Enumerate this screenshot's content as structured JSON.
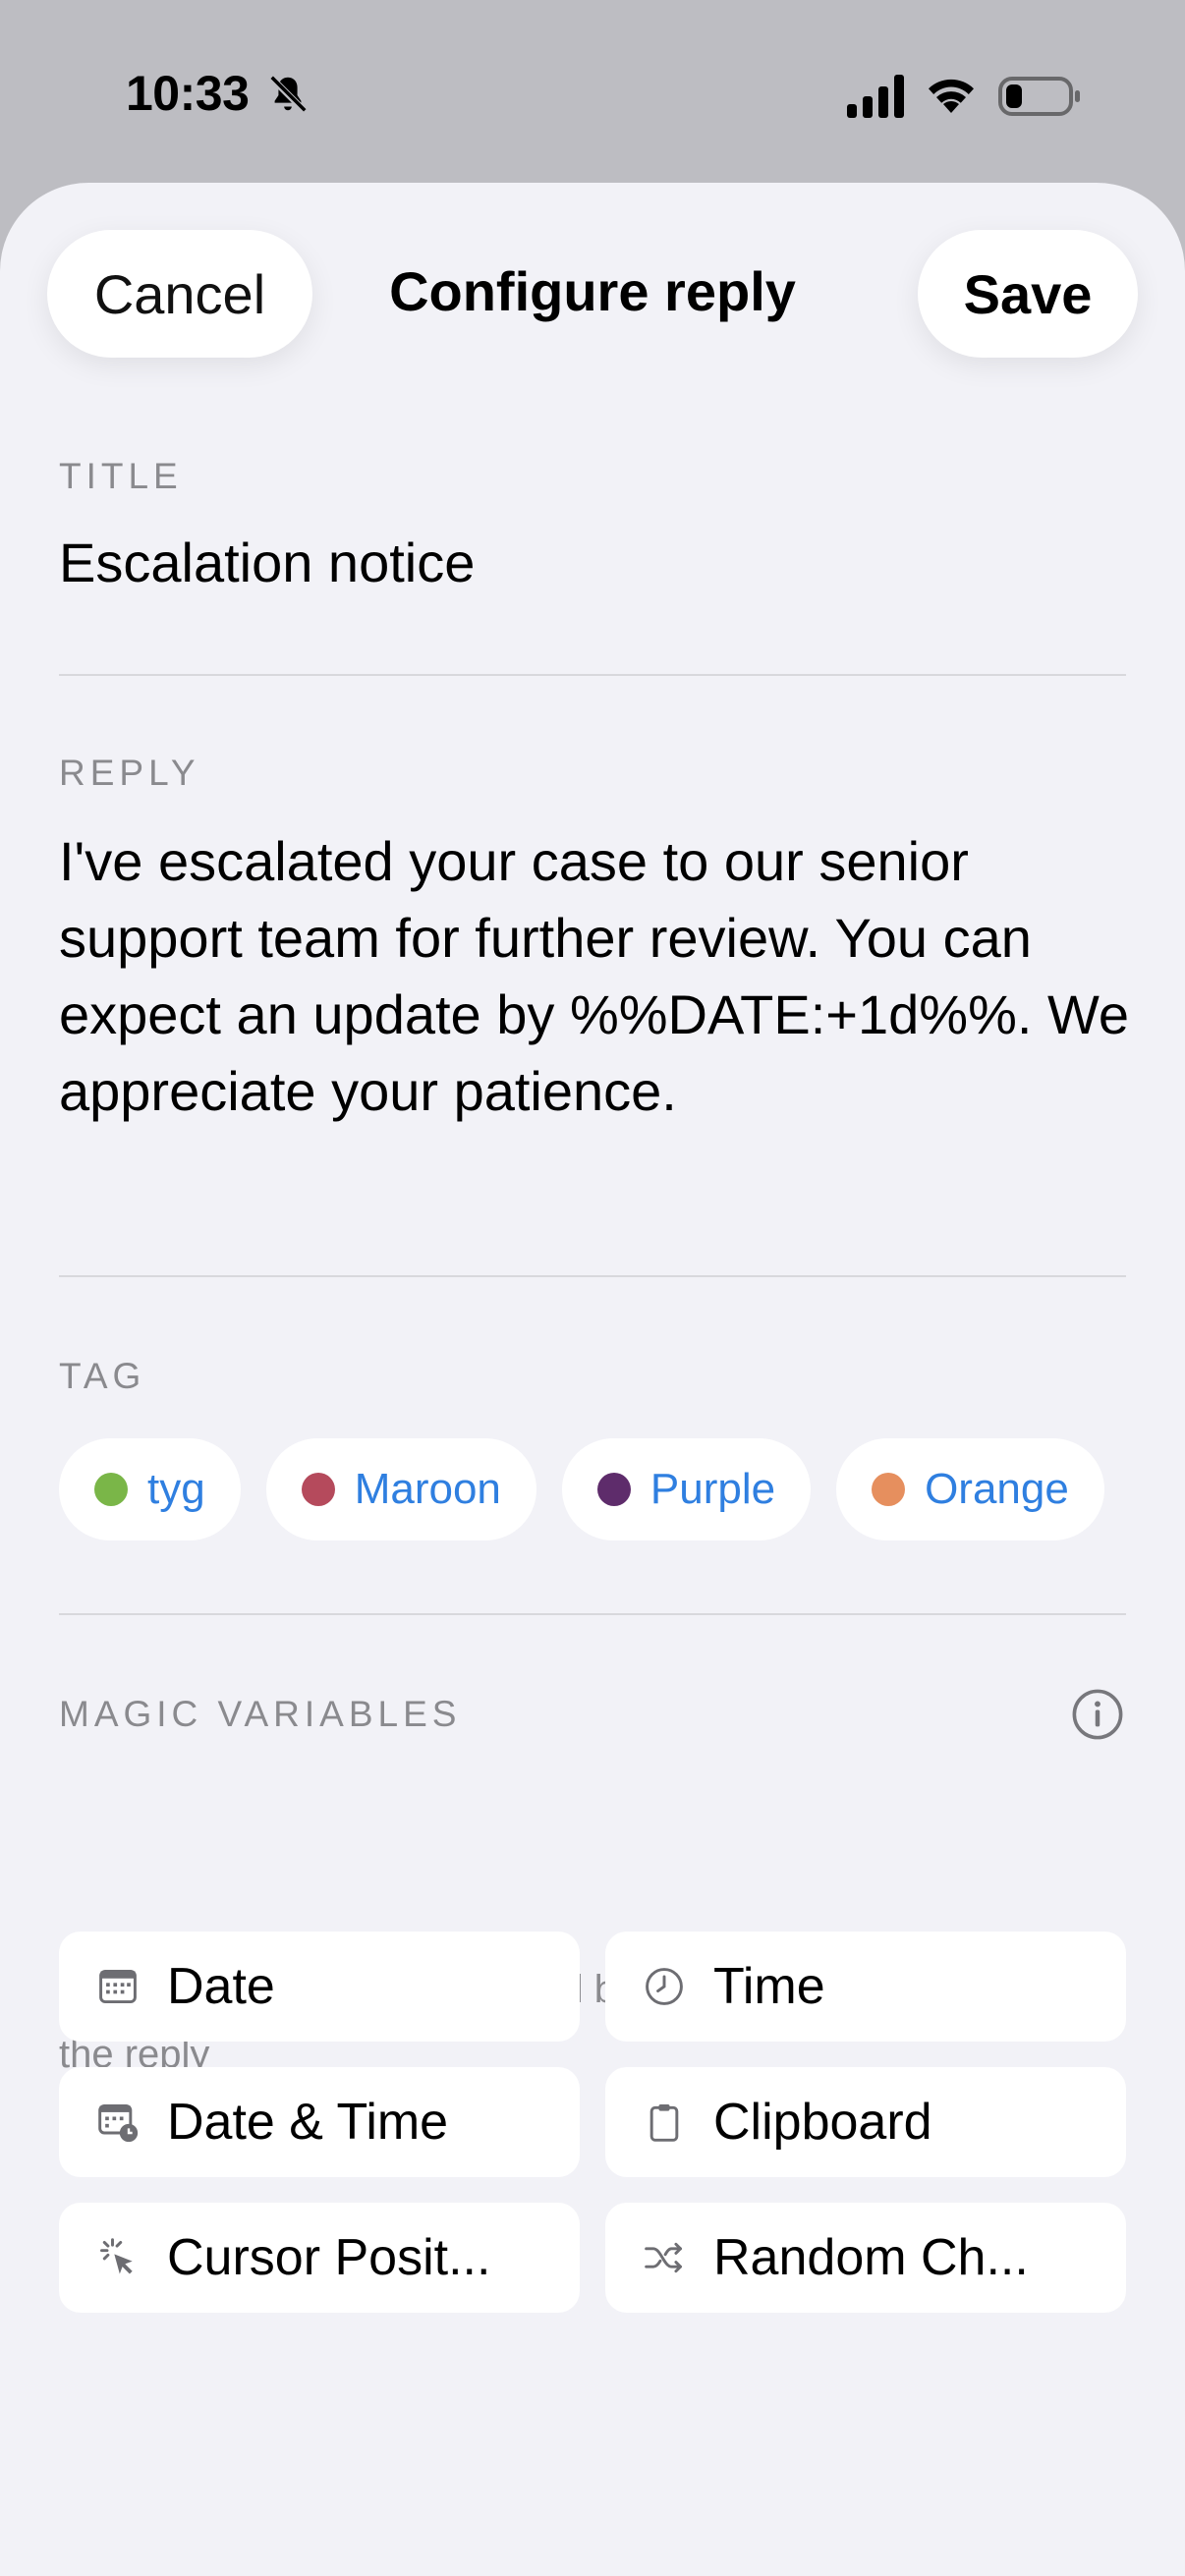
{
  "status_bar": {
    "time": "10:33",
    "icons": [
      "bell-slash-icon",
      "cellular-signal-icon",
      "wifi-icon",
      "battery-icon"
    ]
  },
  "header": {
    "cancel_label": "Cancel",
    "title": "Configure reply",
    "save_label": "Save"
  },
  "title_section": {
    "label": "TITLE",
    "value": "Escalation notice"
  },
  "reply_section": {
    "label": "REPLY",
    "value": "I've escalated your case to our senior support team for further review. You can expect an update by %%DATE:+1d%%. We appreciate your patience."
  },
  "tag_section": {
    "label": "TAG",
    "tags": [
      {
        "label": "tyg",
        "color": "#7ab648"
      },
      {
        "label": "Maroon",
        "color": "#b54a5c"
      },
      {
        "label": "Purple",
        "color": "#5e2c6b"
      },
      {
        "label": "Orange",
        "color": "#e68f5e"
      }
    ]
  },
  "magic_section": {
    "label": "MAGIC VARIABLES",
    "info_icon": "info-circle-icon",
    "help": "Tap to insert variables that will be replaced when sending the reply",
    "variables": [
      {
        "label": "Date",
        "icon": "calendar-icon"
      },
      {
        "label": "Time",
        "icon": "clock-icon"
      },
      {
        "label": "Date & Time",
        "icon": "calendar-clock-icon"
      },
      {
        "label": "Clipboard",
        "icon": "clipboard-icon"
      },
      {
        "label": "Cursor Posit...",
        "icon": "cursor-click-icon"
      },
      {
        "label": "Random Ch...",
        "icon": "shuffle-icon"
      }
    ]
  },
  "colors": {
    "accent": "#2f7fe0",
    "sheet_background": "#f2f2f7",
    "secondary_text": "#8a8a8e"
  }
}
